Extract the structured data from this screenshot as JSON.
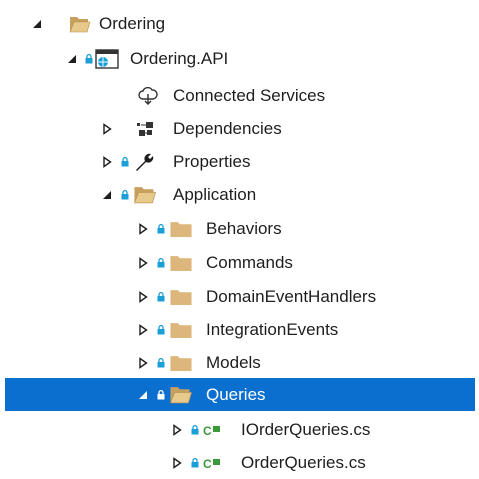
{
  "tree": {
    "ordering": "Ordering",
    "ordering_api": "Ordering.API",
    "connected_services": "Connected Services",
    "dependencies": "Dependencies",
    "properties": "Properties",
    "application": "Application",
    "behaviors": "Behaviors",
    "commands": "Commands",
    "domain_event_handlers": "DomainEventHandlers",
    "integration_events": "IntegrationEvents",
    "models": "Models",
    "queries": "Queries",
    "iorderqueries": "IOrderQueries.cs",
    "orderqueries": "OrderQueries.cs"
  },
  "selected_item": "Queries",
  "icons": {
    "expanded": "triangle-expanded-icon",
    "collapsed": "triangle-collapsed-icon",
    "folder": "folder-icon",
    "open_folder": "open-folder-icon",
    "project": "web-project-icon",
    "lock": "lock-icon",
    "wrench": "wrench-icon",
    "cloud": "connected-services-icon",
    "dependencies": "dependencies-icon",
    "csharp": "csharp-file-icon"
  },
  "colors": {
    "selection": "#0b6fcf",
    "folder": "#dcb67a",
    "lock": "#1a9fd6",
    "csharp": "#3a9a3a"
  }
}
